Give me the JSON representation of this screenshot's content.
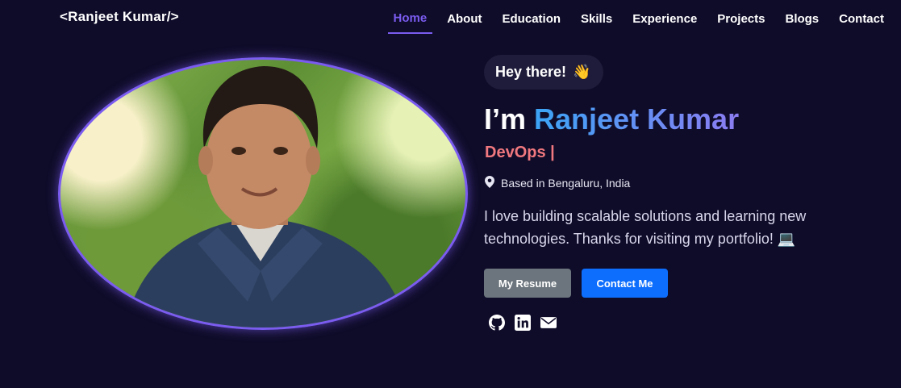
{
  "brand": {
    "label": "<Ranjeet Kumar/>"
  },
  "nav": {
    "items": [
      {
        "label": "Home",
        "active": true
      },
      {
        "label": "About"
      },
      {
        "label": "Education"
      },
      {
        "label": "Skills"
      },
      {
        "label": "Experience"
      },
      {
        "label": "Projects"
      },
      {
        "label": "Blogs"
      },
      {
        "label": "Contact"
      }
    ]
  },
  "hero": {
    "greeting": "Hey there!",
    "greeting_emoji": "👋",
    "headline_prefix": "I’m ",
    "name": "Ranjeet Kumar",
    "role": "DevOps |",
    "location": "Based in Bengaluru, India",
    "bio": "I love building scalable solutions and learning new technologies. Thanks for visiting my portfolio! 💻",
    "resume_label": "My Resume",
    "contact_label": "Contact Me",
    "social_icons": [
      "github-icon",
      "linkedin-icon",
      "email-icon"
    ]
  },
  "colors": {
    "background": "#0f0c29",
    "accent": "#7b5cf0",
    "role": "#f0787e",
    "resume_button": "#6c757d",
    "contact_button": "#0d6efd"
  }
}
